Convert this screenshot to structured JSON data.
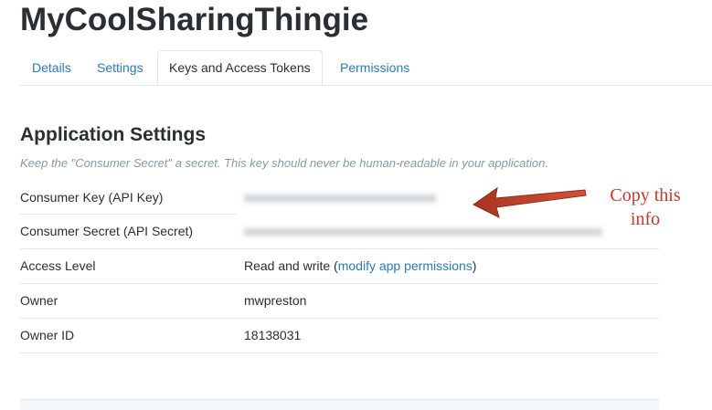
{
  "app": {
    "title": "MyCoolSharingThingie"
  },
  "tabs": [
    {
      "label": "Details",
      "active": false
    },
    {
      "label": "Settings",
      "active": false
    },
    {
      "label": "Keys and Access Tokens",
      "active": true
    },
    {
      "label": "Permissions",
      "active": false
    }
  ],
  "section": {
    "title": "Application Settings",
    "hint": "Keep the \"Consumer Secret\" a secret. This key should never be human-readable in your application."
  },
  "settings": {
    "consumer_key": {
      "label": "Consumer Key (API Key)",
      "value": ""
    },
    "consumer_secret": {
      "label": "Consumer Secret (API Secret)",
      "value": ""
    },
    "access_level": {
      "label": "Access Level",
      "value": "Read and write",
      "open_paren": " (",
      "link": "modify app permissions",
      "close_paren": ")"
    },
    "owner": {
      "label": "Owner",
      "value": "mwpreston"
    },
    "owner_id": {
      "label": "Owner ID",
      "value": "18138031"
    }
  },
  "annotation": {
    "text_line1": "Copy this",
    "text_line2": "info",
    "color": "#c0392b"
  },
  "colors": {
    "link": "#2b7bb9",
    "text": "#292f33",
    "muted": "#8899a6",
    "border": "#e1e8ed"
  }
}
